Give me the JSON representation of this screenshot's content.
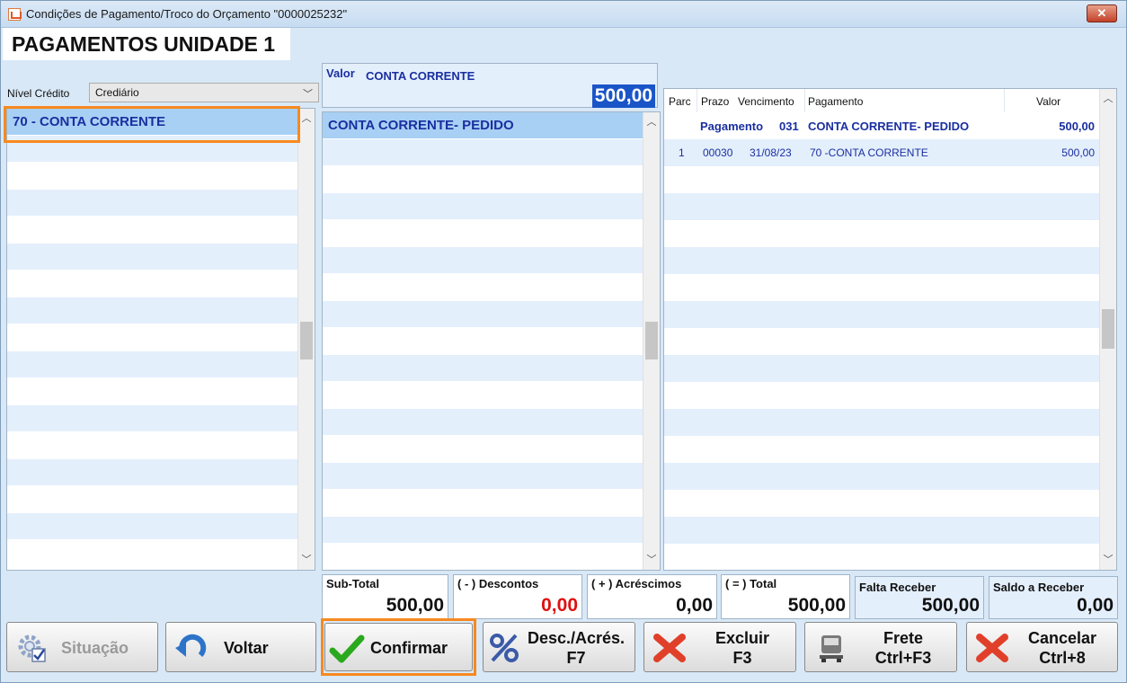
{
  "window": {
    "title": "Condições de Pagamento/Troco do Orçamento \"0000025232\"",
    "close_label": "✕"
  },
  "tab_title": "PAGAMENTOS UNIDADE 1",
  "nivel_credito": {
    "label": "Nível Crédito",
    "value": "Crediário"
  },
  "left_list": {
    "items": [
      "70 - CONTA CORRENTE"
    ]
  },
  "valor_box": {
    "label": "Valor",
    "name": "CONTA CORRENTE",
    "amount": "500,00"
  },
  "middle_list": {
    "items": [
      "CONTA CORRENTE- PEDIDO"
    ]
  },
  "grid": {
    "headers": {
      "parc": "Parc",
      "prazo": "Prazo",
      "vencimento": "Vencimento",
      "pagamento": "Pagamento",
      "valor": "Valor"
    },
    "group_row": {
      "label": "Pagamento",
      "code": "031",
      "pagamento": "CONTA CORRENTE- PEDIDO",
      "valor": "500,00"
    },
    "rows": [
      {
        "parc": "1",
        "prazo": "00030",
        "vencimento": "31/08/23",
        "pagamento": "70 -CONTA CORRENTE",
        "valor": "500,00"
      }
    ]
  },
  "totals": {
    "subtotal": {
      "label": "Sub-Total",
      "value": "500,00"
    },
    "descontos": {
      "label": "( - ) Descontos",
      "value": "0,00"
    },
    "acrescimos": {
      "label": "( + ) Acréscimos",
      "value": "0,00"
    },
    "total": {
      "label": "( = ) Total",
      "value": "500,00"
    },
    "falta_receber": {
      "label": "Falta Receber",
      "value": "500,00"
    },
    "saldo_receber": {
      "label": "Saldo a Receber",
      "value": "0,00"
    }
  },
  "buttons": {
    "situacao": "Situação",
    "voltar": "Voltar",
    "confirmar": "Confirmar",
    "desc_acres": {
      "line1": "Desc./Acrés.",
      "line2": "F7"
    },
    "excluir": {
      "line1": "Excluir",
      "line2": "F3"
    },
    "frete": {
      "line1": "Frete",
      "line2": "Ctrl+F3"
    },
    "cancelar": {
      "line1": "Cancelar",
      "line2": "Ctrl+8"
    }
  },
  "colors": {
    "accent_blue": "#1a2fa0",
    "highlight_orange": "#f7891f",
    "negative_red": "#e01010"
  }
}
